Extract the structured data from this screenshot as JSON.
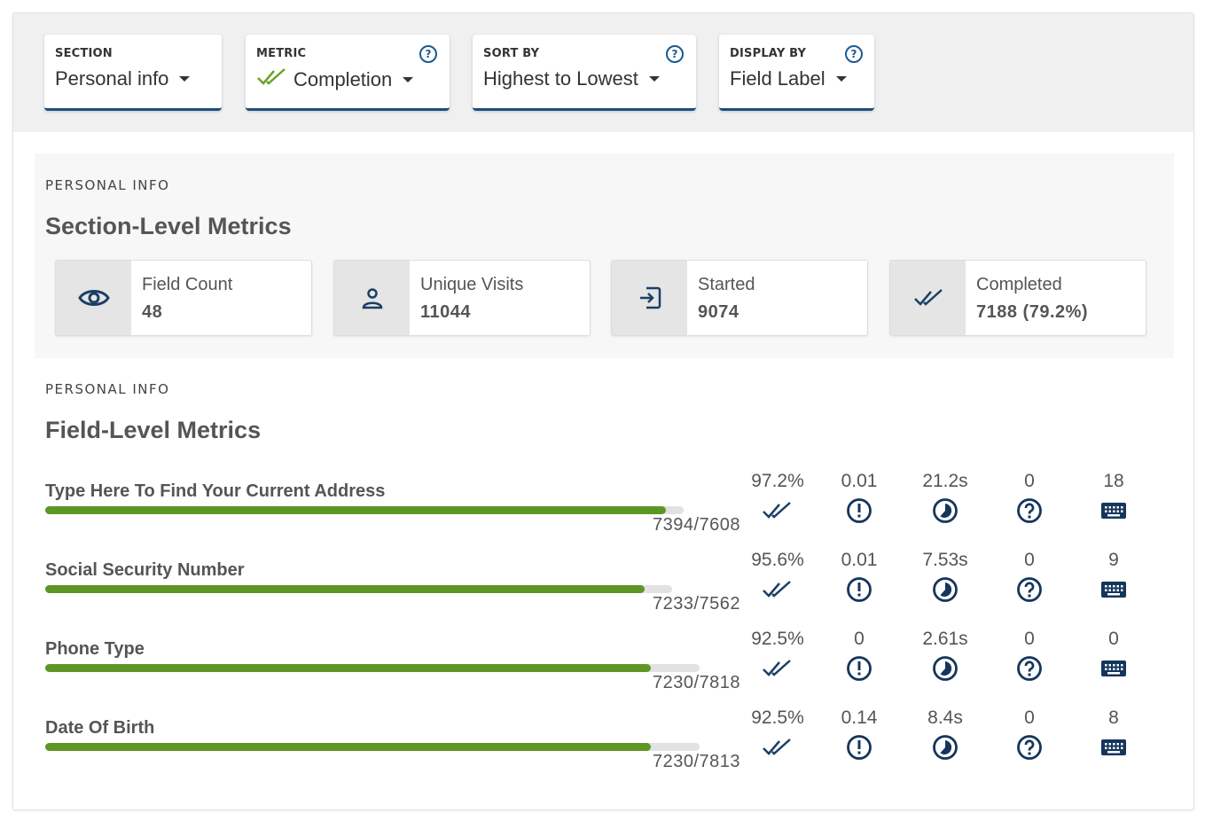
{
  "filters": [
    {
      "label": "SECTION",
      "value": "Personal info",
      "help": false
    },
    {
      "label": "METRIC",
      "value": "Completion",
      "help": true,
      "icon": "double-check-icon"
    },
    {
      "label": "SORT BY",
      "value": "Highest to Lowest",
      "help": true
    },
    {
      "label": "DISPLAY BY",
      "value": "Field Label",
      "help": true
    }
  ],
  "help_glyph": "?",
  "section_overline": "PERSONAL INFO",
  "section_title": "Section-Level Metrics",
  "stats": [
    {
      "label": "Field Count",
      "value": "48",
      "icon": "eye-icon"
    },
    {
      "label": "Unique Visits",
      "value": "11044",
      "icon": "user-icon"
    },
    {
      "label": "Started",
      "value": "9074",
      "icon": "enter-icon"
    },
    {
      "label": "Completed",
      "value": "7188 (79.2%)",
      "icon": "double-check-icon"
    }
  ],
  "field_overline": "PERSONAL INFO",
  "field_title": "Field-Level Metrics",
  "fields": [
    {
      "name": "Type Here To Find Your Current Address",
      "ratio": "7394/7608",
      "completion": "97.2%",
      "errors": "0.01",
      "time": "21.2s",
      "help": "0",
      "keystrokes": "18",
      "fill_fraction": 0.972,
      "track_fraction": 0.8
    },
    {
      "name": "Social Security Number",
      "ratio": "7233/7562",
      "completion": "95.6%",
      "errors": "0.01",
      "time": "7.53s",
      "help": "0",
      "keystrokes": "9",
      "fill_fraction": 0.956,
      "track_fraction": 0.785
    },
    {
      "name": "Phone Type",
      "ratio": "7230/7818",
      "completion": "92.5%",
      "errors": "0",
      "time": "2.61s",
      "help": "0",
      "keystrokes": "0",
      "fill_fraction": 0.925,
      "track_fraction": 0.82
    },
    {
      "name": "Date Of Birth",
      "ratio": "7230/7813",
      "completion": "92.5%",
      "errors": "0.14",
      "time": "8.4s",
      "help": "0",
      "keystrokes": "8",
      "fill_fraction": 0.925,
      "track_fraction": 0.82
    }
  ],
  "metric_icons": [
    "double-check-icon",
    "alert-icon",
    "clock-icon",
    "help-icon",
    "keyboard-icon"
  ],
  "colors": {
    "accent": "#1b4f7d",
    "icon": "#1b5a8f",
    "success": "#5e9626",
    "check_green": "#6aa32b"
  }
}
